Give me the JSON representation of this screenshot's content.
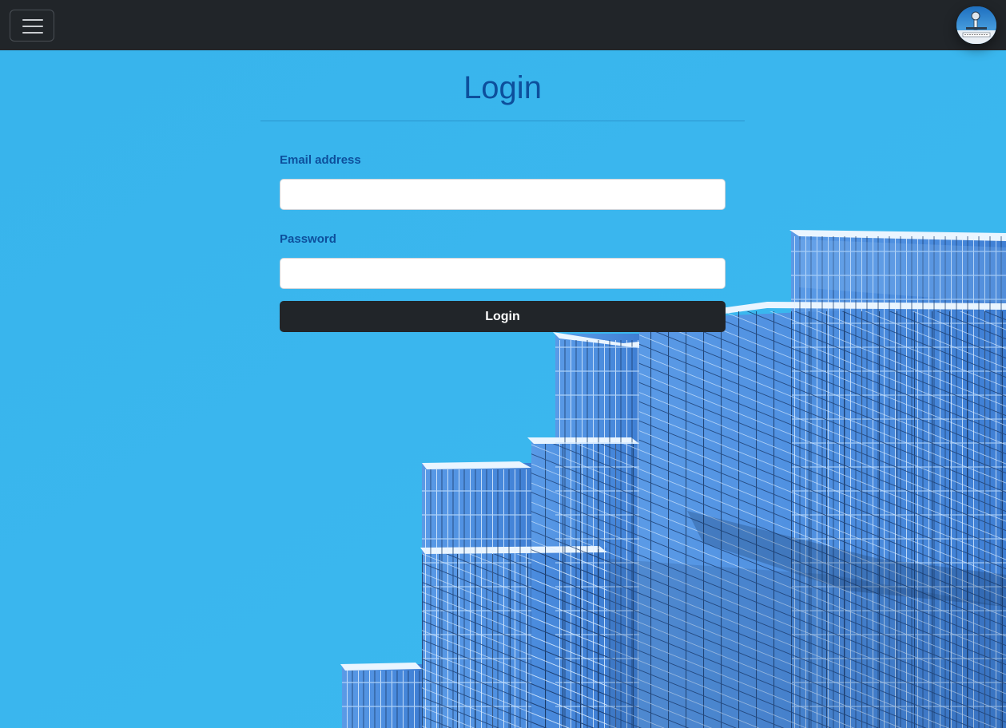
{
  "navbar": {
    "toggler_icon": "hamburger-menu-icon",
    "avatar_icon": "user-avatar-icon"
  },
  "login": {
    "title": "Login",
    "email_label": "Email address",
    "email_value": "",
    "password_label": "Password",
    "password_value": "",
    "submit_label": "Login"
  },
  "colors": {
    "navbar_bg": "#212529",
    "page_bg": "#3ab6ee",
    "title_color": "#0d4f9c",
    "button_bg": "#212529",
    "button_text": "#ffffff"
  }
}
